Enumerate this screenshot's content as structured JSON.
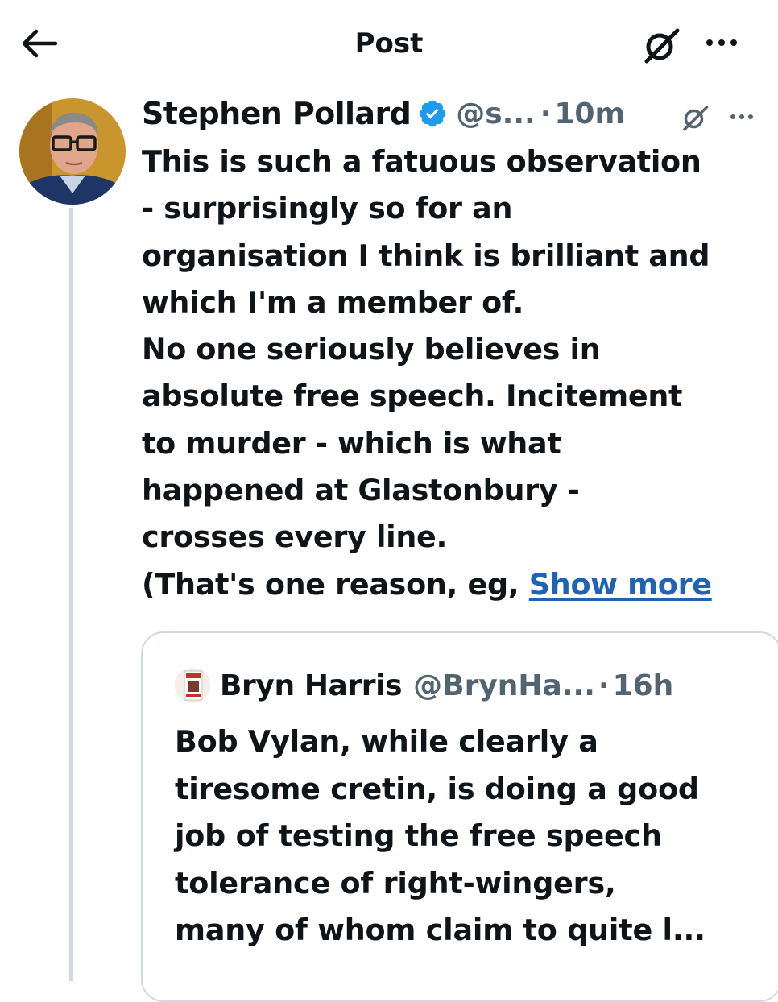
{
  "header": {
    "title": "Post",
    "back_icon": "arrow-left-icon",
    "grok_icon": "grok-icon",
    "more_icon": "more-horizontal-icon"
  },
  "post": {
    "author": {
      "name": "Stephen Pollard",
      "verified": true,
      "handle": "@s...",
      "avatar_icon": "author-avatar"
    },
    "separator": "·",
    "time": "10m",
    "lines": [
      "This is such a fatuous observation",
      "- surprisingly so for an",
      "organisation I think is brilliant and",
      "which I'm a member of.",
      "No one seriously believes in",
      "absolute free speech. Incitement",
      "to murder - which is what",
      "happened at Glastonbury -",
      "crosses every line."
    ],
    "last_line": "(That's one reason, eg,",
    "show_more": "Show more"
  },
  "quote": {
    "author": {
      "name": "Bryn Harris",
      "handle": "@BrynHa...",
      "avatar_icon": "quote-avatar"
    },
    "separator": "·",
    "time": "16h",
    "lines": [
      "Bob Vylan, while clearly a",
      "tiresome cretin, is doing a good",
      "job of testing the free speech",
      "tolerance of right-wingers,",
      "many of whom claim to quite l..."
    ]
  },
  "colors": {
    "text": "#0f1419",
    "secondary": "#536471",
    "link": "#1d64b7",
    "verified": "#1d9bf0",
    "border": "#cfd9de"
  }
}
